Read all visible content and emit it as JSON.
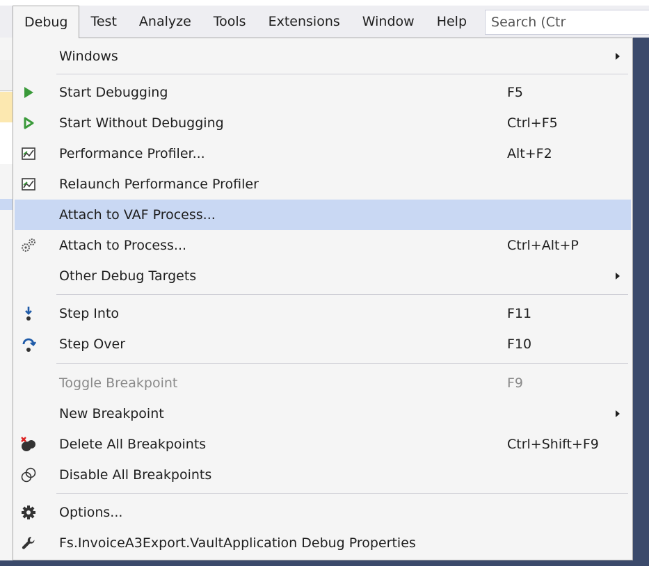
{
  "menubar": {
    "items": [
      "Debug",
      "Test",
      "Analyze",
      "Tools",
      "Extensions",
      "Window",
      "Help"
    ],
    "search_placeholder": "Search (Ctr"
  },
  "menu": {
    "items": [
      {
        "label": "Windows",
        "shortcut": "",
        "submenu": true,
        "icon": ""
      },
      {
        "label": "Start Debugging",
        "shortcut": "F5",
        "icon": "play-solid-icon"
      },
      {
        "label": "Start Without Debugging",
        "shortcut": "Ctrl+F5",
        "icon": "play-outline-icon"
      },
      {
        "label": "Performance Profiler...",
        "shortcut": "Alt+F2",
        "icon": "performance-chart-icon"
      },
      {
        "label": "Relaunch Performance Profiler",
        "shortcut": "",
        "icon": "performance-chart-icon"
      },
      {
        "label": "Attach to VAF Process...",
        "shortcut": "",
        "icon": "",
        "highlighted": true
      },
      {
        "label": "Attach to Process...",
        "shortcut": "Ctrl+Alt+P",
        "icon": "attach-gears-icon"
      },
      {
        "label": "Other Debug Targets",
        "shortcut": "",
        "submenu": true,
        "icon": ""
      },
      {
        "label": "Step Into",
        "shortcut": "F11",
        "icon": "step-into-icon"
      },
      {
        "label": "Step Over",
        "shortcut": "F10",
        "icon": "step-over-icon"
      },
      {
        "label": "Toggle Breakpoint",
        "shortcut": "F9",
        "icon": "",
        "disabled": true
      },
      {
        "label": "New Breakpoint",
        "shortcut": "",
        "submenu": true,
        "icon": ""
      },
      {
        "label": "Delete All Breakpoints",
        "shortcut": "Ctrl+Shift+F9",
        "icon": "delete-breakpoints-icon"
      },
      {
        "label": "Disable All Breakpoints",
        "shortcut": "",
        "icon": "disable-breakpoints-icon"
      },
      {
        "label": "Options...",
        "shortcut": "",
        "icon": "gear-icon"
      },
      {
        "label": "Fs.InvoiceA3Export.VaultApplication Debug Properties",
        "shortcut": "",
        "icon": "wrench-icon"
      }
    ]
  },
  "colors": {
    "menu_bg": "#f5f5f5",
    "highlight": "#c9d8f3",
    "play_green": "#3a9a3a",
    "step_blue": "#1e5aa8",
    "ide_dark": "#3b4a6b"
  }
}
